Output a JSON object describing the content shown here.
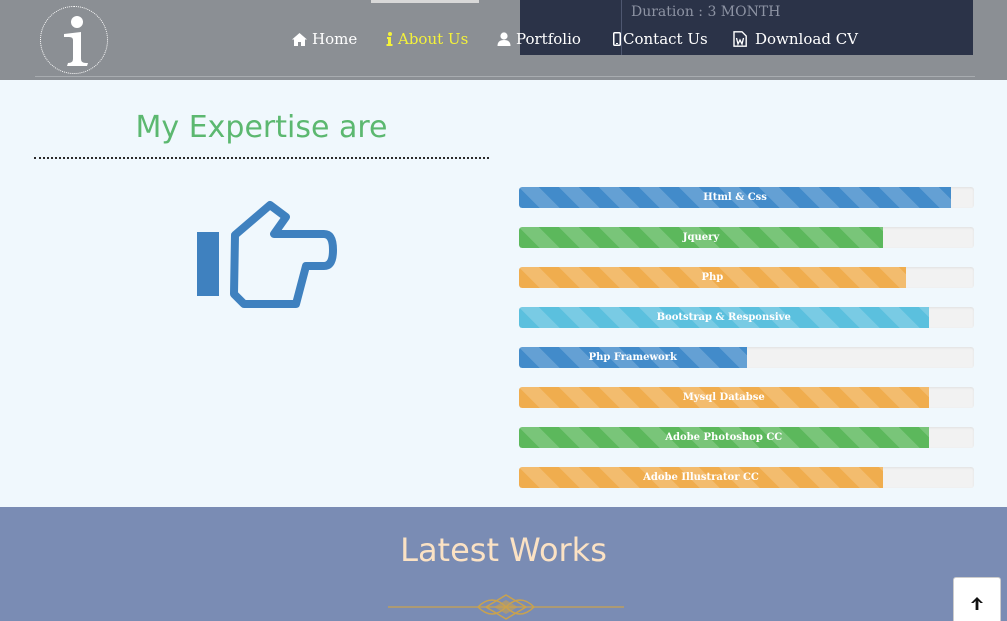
{
  "header": {
    "logo_icon": "info-icon",
    "duration_label": "Duration :  3 MONTH",
    "nav": [
      {
        "label": "Home",
        "icon": "home-icon",
        "active": false
      },
      {
        "label": "About Us",
        "icon": "info-icon",
        "active": true
      },
      {
        "label": "Portfolio",
        "icon": "user-icon",
        "active": false
      },
      {
        "label": "Contact Us",
        "icon": "mobile-icon",
        "active": false
      },
      {
        "label": "Download CV",
        "icon": "word-file-icon",
        "active": false
      }
    ]
  },
  "expertise": {
    "title": "My Expertise are",
    "icon": "hand-pointing-right-icon",
    "skills": [
      {
        "label": "Html & Css",
        "percent": 95,
        "color": "#428bca"
      },
      {
        "label": "Jquery",
        "percent": 80,
        "color": "#5cb85c"
      },
      {
        "label": "Php",
        "percent": 85,
        "color": "#f0ad4e"
      },
      {
        "label": "Bootstrap & Responsive",
        "percent": 90,
        "color": "#5bc0de"
      },
      {
        "label": "Php Framework",
        "percent": 50,
        "color": "#428bca"
      },
      {
        "label": "Mysql Databse",
        "percent": 90,
        "color": "#f0ad4e"
      },
      {
        "label": "Adobe Photoshop CC",
        "percent": 90,
        "color": "#5cb85c"
      },
      {
        "label": "Adobe Illustrator CC",
        "percent": 80,
        "color": "#f0ad4e"
      }
    ]
  },
  "latest_works": {
    "title": "Latest Works",
    "ornament_icon": "ornament-divider-icon"
  },
  "back_to_top": {
    "icon": "arrow-up-icon"
  },
  "colors": {
    "header_bg": "#8b8f94",
    "nav_active": "#f4f23a",
    "expertise_title": "#5cb870",
    "works_bg": "#7a8cb4",
    "works_title": "#fbe2c4"
  }
}
